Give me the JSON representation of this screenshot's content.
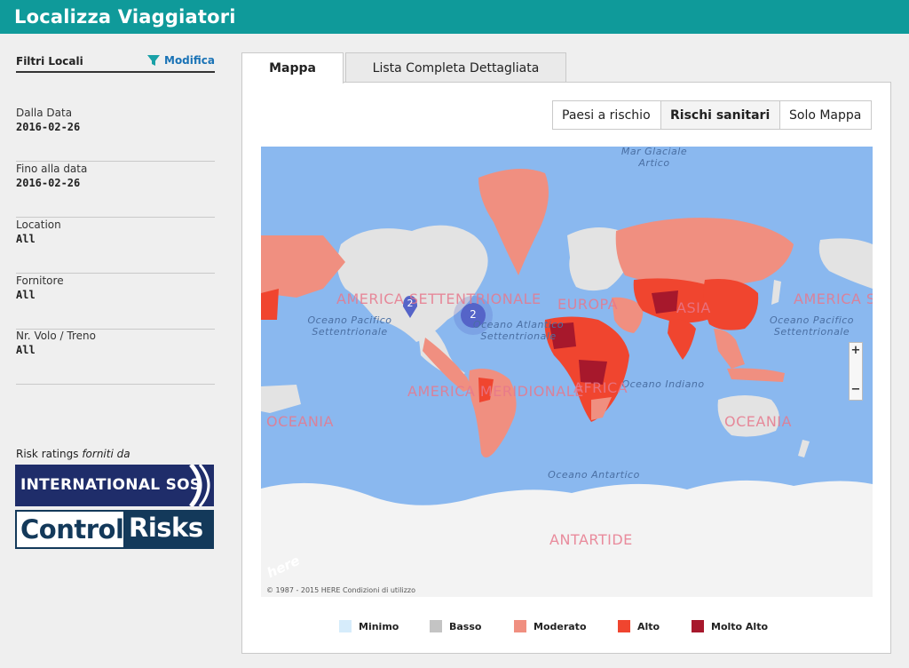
{
  "app": {
    "title": "Localizza Viaggiatori"
  },
  "sidebar": {
    "filters_title": "Filtri Locali",
    "edit_label": "Modifica",
    "filters": [
      {
        "label": "Dalla Data",
        "value": "2016-02-26"
      },
      {
        "label": "Fino alla data",
        "value": "2016-02-26"
      },
      {
        "label": "Location",
        "value": "All"
      },
      {
        "label": "Fornitore",
        "value": "All"
      },
      {
        "label": "Nr. Volo / Treno",
        "value": "All"
      }
    ],
    "risk_by": {
      "prefix": "Risk ratings ",
      "suffix": "forniti da"
    },
    "logos": {
      "isos": "INTERNATIONAL SOS",
      "cr_left": "Control",
      "cr_right": "Risks"
    }
  },
  "tabs": [
    {
      "label": "Mappa",
      "active": true
    },
    {
      "label": "Lista Completa Dettagliata",
      "active": false
    }
  ],
  "view_toggle": [
    {
      "label": "Paesi a rischio",
      "active": false
    },
    {
      "label": "Rischi sanitari",
      "active": true
    },
    {
      "label": "Solo Mappa",
      "active": false
    }
  ],
  "map": {
    "oceans": {
      "arctic": "Mar Glaciale\nArtico",
      "pacific_left": "Oceano Pacifico\nSettentrionale",
      "atlantic": "Oceano Atlantico\nSettentrionale",
      "pacific_right": "Oceano Pacifico\nSettentrionale",
      "indian": "Oceano Indiano",
      "antarctic": "Oceano Antartico"
    },
    "continents": {
      "north_america": "AMERICA SETTENTRIONALE",
      "europe": "EUROPA",
      "asia": "ASIA",
      "south_america": "AMERICA MERIDIONALE",
      "africa": "AFRICA",
      "oceania_left": "OCEANIA",
      "oceania_right": "OCEANIA",
      "america_right": "AMERICA S",
      "antarctica": "ANTARTIDE"
    },
    "markers": {
      "pin": "2",
      "cluster": "2"
    },
    "zoom_in": "+",
    "zoom_out": "−",
    "here_logo": "here",
    "copyright": "© 1987 - 2015 HERE Condizioni di utilizzo"
  },
  "legend": [
    {
      "label": "Minimo",
      "color": "#d6ecfb"
    },
    {
      "label": "Basso",
      "color": "#c4c4c4"
    },
    {
      "label": "Moderato",
      "color": "#f08f80"
    },
    {
      "label": "Alto",
      "color": "#f0452f"
    },
    {
      "label": "Molto Alto",
      "color": "#a7182c"
    }
  ],
  "colors": {
    "header": "#0f9a9a",
    "ocean": "#8ab8ef",
    "land": "#e3e3e3",
    "moderate": "#f08f80",
    "high": "#f0452f",
    "very_high": "#a7182c",
    "marker": "#5564c8"
  }
}
